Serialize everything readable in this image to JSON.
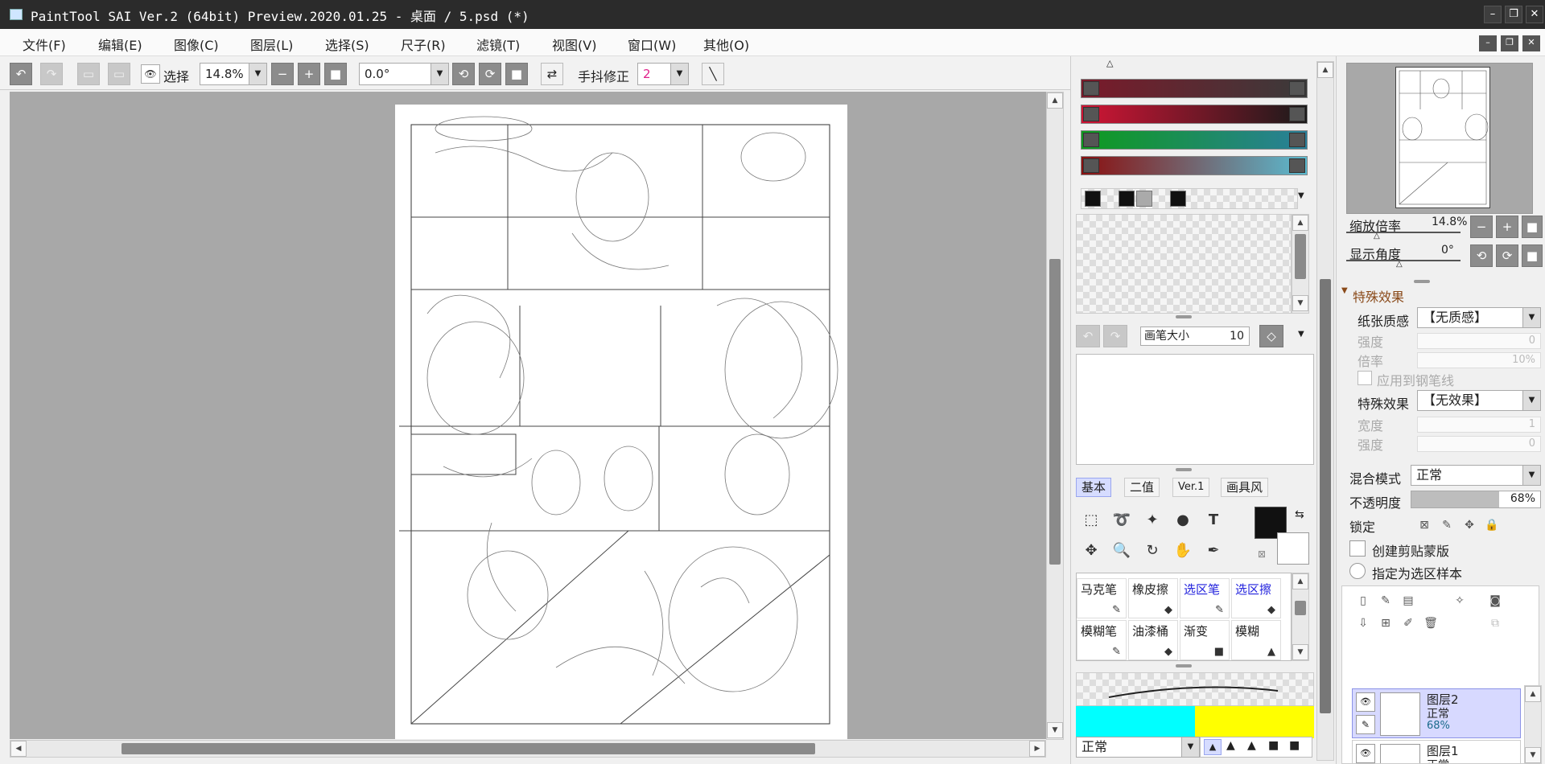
{
  "window": {
    "title": "PaintTool SAI Ver.2 (64bit) Preview.2020.01.25 - 桌面 / 5.psd (*)",
    "min": "–",
    "restore": "❐",
    "close": "✕"
  },
  "menu": [
    "文件(F)",
    "编辑(E)",
    "图像(C)",
    "图层(L)",
    "选择(S)",
    "尺子(R)",
    "滤镜(T)",
    "视图(V)",
    "窗口(W)",
    "其他(O)"
  ],
  "toolbar": {
    "select_label": "选择",
    "zoom_value": "14.8%",
    "rotation_value": "0.0°",
    "stabilizer_label": "手抖修正",
    "stabilizer_value": "2"
  },
  "color_sliders": [
    {
      "name": "hue",
      "from": "#7a1a2a",
      "to": "#3a3a3a"
    },
    {
      "name": "red",
      "from": "#d01535",
      "to": "#1a1a1a"
    },
    {
      "name": "green",
      "from": "#0e9a1e",
      "to": "#2a7f9a"
    },
    {
      "name": "blue",
      "from": "#8a1010",
      "to": "#5bbbd0"
    }
  ],
  "brush": {
    "size_label": "画笔大小",
    "size_value": "10"
  },
  "tool_tabs": [
    "基本",
    "二值",
    "Ver.1",
    "画具风"
  ],
  "brushes": [
    {
      "label": "马克笔",
      "blue": false,
      "icon": "✎"
    },
    {
      "label": "橡皮擦",
      "blue": false,
      "icon": "◆"
    },
    {
      "label": "选区笔",
      "blue": true,
      "icon": "✎"
    },
    {
      "label": "选区擦",
      "blue": true,
      "icon": "◆"
    },
    {
      "label": "模糊笔",
      "blue": false,
      "icon": "✎"
    },
    {
      "label": "油漆桶",
      "blue": false,
      "icon": "◆"
    },
    {
      "label": "渐变",
      "blue": false,
      "icon": "■"
    },
    {
      "label": "模糊",
      "blue": false,
      "icon": "▲"
    }
  ],
  "blend_bottom": "正常",
  "navigator": {
    "zoom_label": "缩放倍率",
    "zoom_value": "14.8%",
    "angle_label": "显示角度",
    "angle_value": "0°"
  },
  "effects": {
    "section_label": "特殊效果",
    "paper_label": "纸张质感",
    "paper_value": "【无质感】",
    "strength_label": "强度",
    "strength_value": "0",
    "scale_label": "倍率",
    "scale_value": "10%",
    "apply_pen_label": "应用到钢笔线",
    "effect_label": "特殊效果",
    "effect_value": "【无效果】",
    "width_label": "宽度",
    "width_value": "1",
    "strength2_label": "强度",
    "strength2_value": "0"
  },
  "layer_props": {
    "blend_label": "混合模式",
    "blend_value": "正常",
    "opacity_label": "不透明度",
    "opacity_value": "68%",
    "opacity_fraction": 0.68,
    "lock_label": "锁定",
    "clip_label": "创建剪贴蒙版",
    "sample_label": "指定为选区样本"
  },
  "layers": [
    {
      "name": "图层2",
      "mode": "正常",
      "opacity": "68%"
    },
    {
      "name": "图层1",
      "mode": "正常"
    }
  ]
}
